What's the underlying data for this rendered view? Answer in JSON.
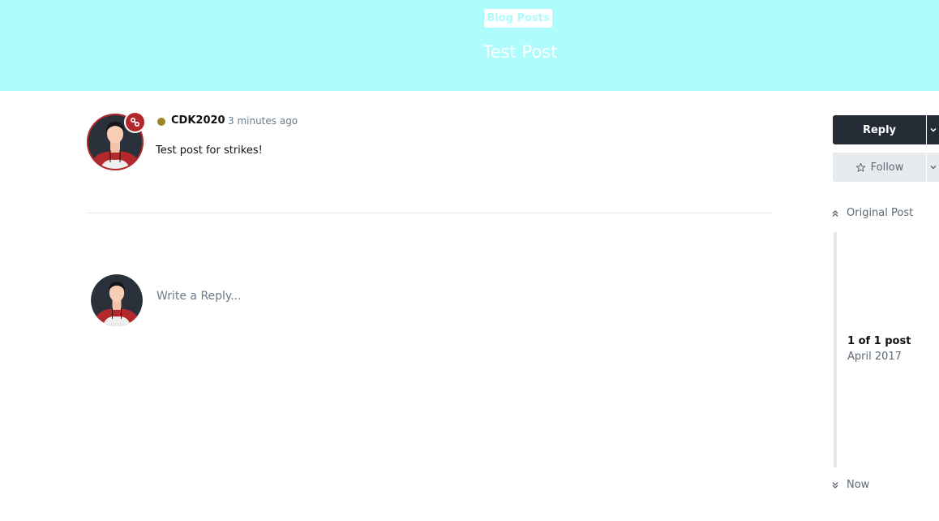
{
  "header": {
    "category_label": "Blog Posts",
    "title": "Test Post"
  },
  "post": {
    "username": "CDK2020",
    "timestamp": "3 minutes ago",
    "content": "Test post for strikes!"
  },
  "reply": {
    "placeholder": "Write a Reply..."
  },
  "sidebar": {
    "reply_label": "Reply",
    "follow_label": "Follow",
    "timeline": {
      "top_label": "Original Post",
      "count_label": "1 of 1 post",
      "date_label": "April 2017",
      "bottom_label": "Now"
    }
  },
  "colors": {
    "header_bg": "#aefcfc",
    "dark_button": "#242c36",
    "status": "#9d8428",
    "avatar_ring": "#b3282b"
  }
}
